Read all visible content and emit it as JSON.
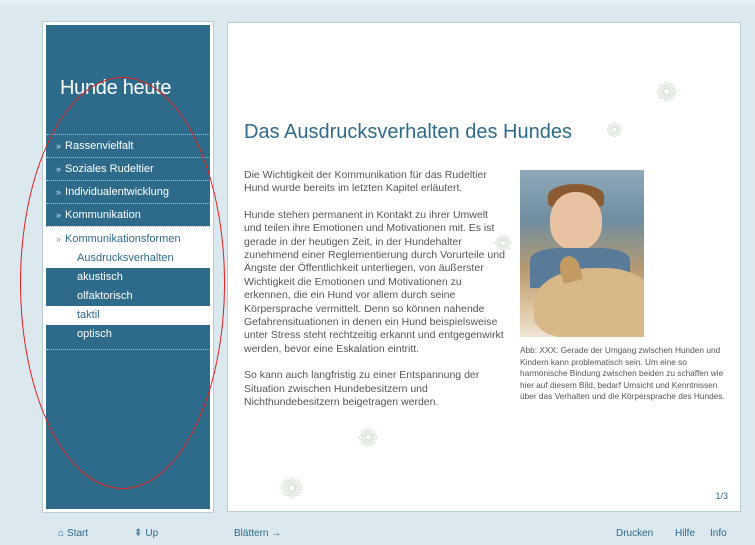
{
  "sidebar": {
    "title": "Hunde heute",
    "items": [
      {
        "label": "Rassenvielfalt",
        "arrow": "»"
      },
      {
        "label": "Soziales Rudeltier",
        "arrow": "»"
      },
      {
        "label": "Individualentwicklung",
        "arrow": "»"
      },
      {
        "label": "Kommunikation",
        "arrow": "»"
      },
      {
        "label": "Kommunikationsformen",
        "arrow": "»"
      }
    ],
    "subitems": [
      {
        "label": "Ausdrucksverhalten"
      },
      {
        "label": "akustisch"
      },
      {
        "label": "olfaktorisch"
      },
      {
        "label": "taktil"
      },
      {
        "label": "optisch"
      }
    ]
  },
  "main": {
    "title": "Das Ausdrucksverhalten des Hundes",
    "paragraphs": [
      "Die Wichtigkeit der Kommunikation für das Rudeltier Hund wurde bereits im letzten Kapitel erläutert.",
      "Hunde stehen permanent in Kontakt zu ihrer Umwelt und teilen ihre Emotionen und Motivationen mit. Es ist gerade in der heutigen Zeit, in der Hundehalter zunehmend einer Reglementierung durch Vorurteile und Ängste der Öffentlichkeit unterliegen, von äußerster Wichtigkeit die Emotionen und Motivationen zu erkennen, die ein Hund vor allem durch seine Körpersprache vermittelt. Denn so können nahende Gefahrensituationen in denen ein Hund beispielsweise unter Stress steht rechtzeitig erkannt und entgegenwirkt werden, bevor eine Eskalation eintritt.",
      "So kann auch langfristig zu einer Entspannung der Situation zwischen Hundebesitzern und Nichthundebesitzern beigetragen werden."
    ],
    "caption": "Abb: XXX: Gerade der Umgang zwischen Hunden und Kindern kann problematisch sein. Um eine so harmonische Bindung zwischen beiden zu schaffen wie hier auf diesem Bild, bedarf Umsicht und Kenntnissen über das Verhalten und die Körpersprache des Hundes.",
    "page_number": "1/3"
  },
  "footer": {
    "start_label": "Start",
    "start_icon": "⌂",
    "up_label": "Up",
    "up_icon": "⇞",
    "browse_label": "Blättern",
    "browse_icon": "→",
    "print_label": "Drucken",
    "help_label": "Hilfe",
    "info_label": "Info"
  },
  "colors": {
    "accent": "#2e6b8a",
    "background": "#dbe8ee",
    "annotation": "#e02020"
  }
}
